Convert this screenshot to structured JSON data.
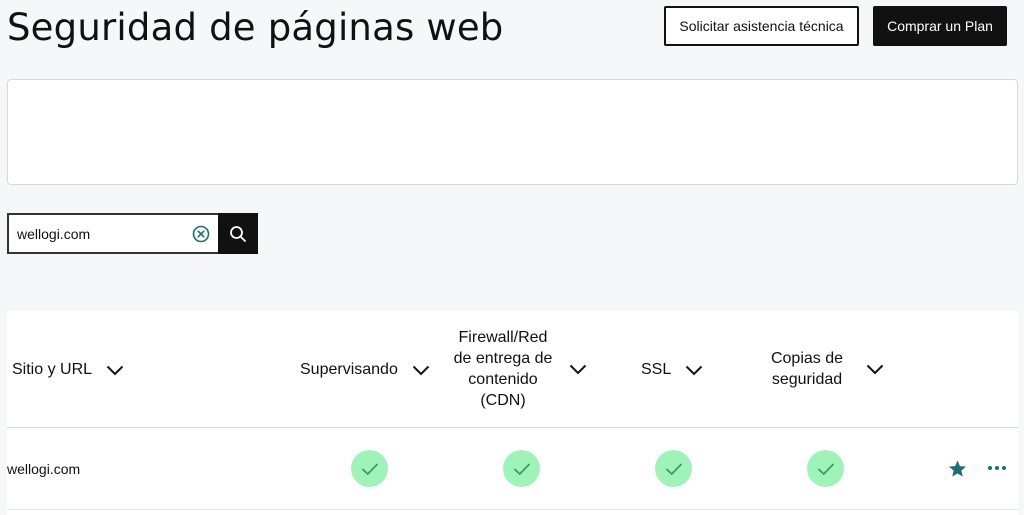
{
  "header": {
    "title": "Seguridad de páginas web",
    "support_button": "Solicitar asistencia técnica",
    "buy_button": "Comprar un Plan"
  },
  "search": {
    "value": "wellogi.com",
    "placeholder": "",
    "clear_icon": "clear-circle-icon",
    "search_icon": "search-icon"
  },
  "table": {
    "columns": [
      {
        "label": "Sitio y URL"
      },
      {
        "label": "Supervisando"
      },
      {
        "label": "Firewall/Red de entrega de contenido (CDN)"
      },
      {
        "label": "SSL"
      },
      {
        "label": "Copias de seguridad"
      }
    ],
    "rows": [
      {
        "site": "wellogi.com",
        "monitoring": true,
        "firewall_cdn": true,
        "ssl": true,
        "backups": true,
        "favorite": true
      }
    ]
  },
  "colors": {
    "background": "#f5f7f8",
    "dark": "#111111",
    "check_bg": "#9ff3b9",
    "check_mark": "#2e8b57",
    "accent_teal": "#1b6f70"
  }
}
